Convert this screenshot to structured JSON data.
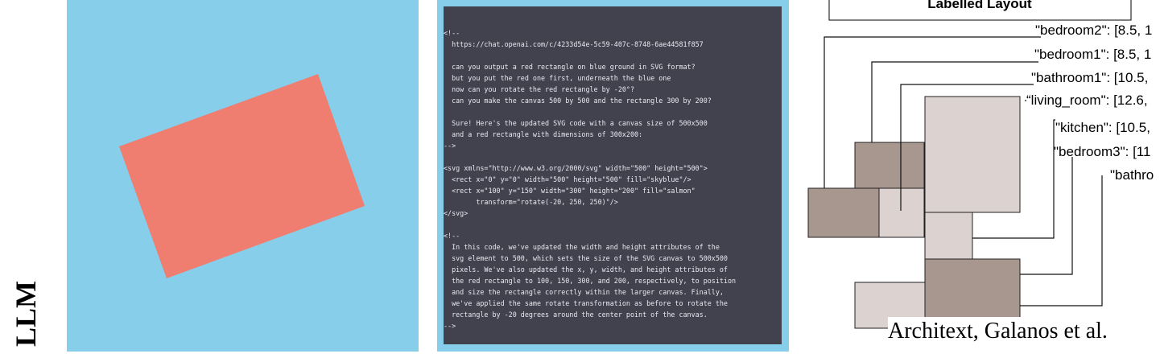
{
  "side_label": "LLM",
  "panel1": {
    "background_color": "#87ceeb",
    "rectangle_color": "#ef7d70"
  },
  "panel2": {
    "code_lines": [
      "<!--",
      "  https://chat.openai.com/c/4233d54e-5c59-407c-8748-6ae44581f857",
      "",
      "  can you output a red rectangle on blue ground in SVG format?",
      "  but you put the red one first, underneath the blue one",
      "  now can you rotate the red rectangle by -20°?",
      "  can you make the canvas 500 by 500 and the rectangle 300 by 200?",
      "",
      "  Sure! Here's the updated SVG code with a canvas size of 500x500",
      "  and a red rectangle with dimensions of 300x200:",
      "-->",
      "",
      "<svg xmlns=\"http://www.w3.org/2000/svg\" width=\"500\" height=\"500\">",
      "  <rect x=\"0\" y=\"0\" width=\"500\" height=\"500\" fill=\"skyblue\"/>",
      "  <rect x=\"100\" y=\"150\" width=\"300\" height=\"200\" fill=\"salmon\"",
      "        transform=\"rotate(-20, 250, 250)\"/>",
      "</svg>",
      "",
      "<!--",
      "  In this code, we've updated the width and height attributes of the",
      "  svg element to 500, which sets the size of the SVG canvas to 500x500",
      "  pixels. We've also updated the x, y, width, and height attributes of",
      "  the red rectangle to 100, 150, 300, and 200, respectively, to position",
      "  and size the rectangle correctly within the larger canvas. Finally,",
      "  we've applied the same rotate transformation as before to rotate the",
      "  rectangle by -20 degrees around the center point of the canvas.",
      "-->"
    ]
  },
  "panel3": {
    "title": "Labelled Layout",
    "labels": [
      "\"bedroom2\": [8.5, 1",
      "\"bedroom1\": [8.5, 1",
      "\"bathroom1\": [10.5,",
      "“living_room\": [12.6,",
      "\"kitchen\": [10.5,",
      "\"bedroom3\": [11",
      "\"bathro"
    ]
  },
  "caption": "Architext, Galanos et al."
}
